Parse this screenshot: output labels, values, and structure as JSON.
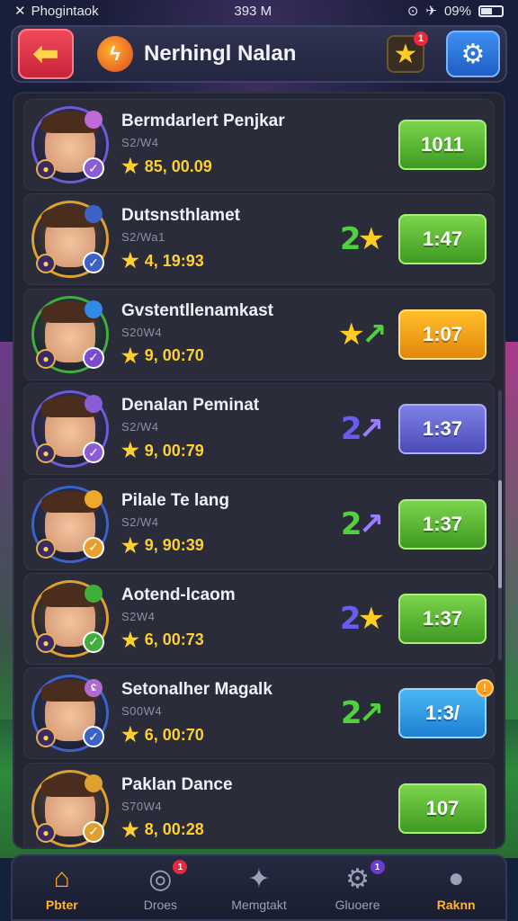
{
  "status_bar": {
    "app": "Phogintaok",
    "time": "393 M",
    "battery": "09%"
  },
  "header": {
    "title": "Nerhingl Nalan",
    "notif": "1"
  },
  "players": [
    {
      "name": "Bermdarlert Penjkar",
      "sub": "S2/W4",
      "score": "85, 00.09",
      "rank": "",
      "rank_colors": [
        "#ffffff",
        "#ffffff"
      ],
      "time": "1011",
      "btn": "green",
      "ring": "#6b5bd6",
      "badge_color": "#8a5cd6",
      "top_badge": "",
      "top_color": "#c06ad8",
      "alert": ""
    },
    {
      "name": "Dutsnsthlamet",
      "sub": "S2/Wa1",
      "score": "4, 19:93",
      "rank": "2★",
      "rank_colors": [
        "#4fd23c",
        "#ffcc22"
      ],
      "time": "1:47",
      "btn": "green",
      "ring": "#e0a030",
      "badge_color": "#3c62c8",
      "top_badge": "",
      "top_color": "#3c62c8",
      "alert": ""
    },
    {
      "name": "Gvstentllenamkast",
      "sub": "S20W4",
      "score": "9, 00:70",
      "rank": "★↗",
      "rank_colors": [
        "#ffcc22",
        "#4fd23c"
      ],
      "time": "1:07",
      "btn": "orange",
      "ring": "#3fae3c",
      "badge_color": "#7a4ad0",
      "top_badge": "",
      "top_color": "#2f8ae8",
      "alert": ""
    },
    {
      "name": "Denalan Peminat",
      "sub": "S2/W4",
      "score": "9, 00:79",
      "rank": "2↗",
      "rank_colors": [
        "#6a5cf0",
        "#9b7cff"
      ],
      "time": "1:37",
      "btn": "purple",
      "ring": "#6b5bd6",
      "badge_color": "#8a5cd6",
      "top_badge": "",
      "top_color": "#8a5cd6",
      "alert": ""
    },
    {
      "name": "Pilale Te lang",
      "sub": "S2/W4",
      "score": "9, 90:39",
      "rank": "2↗",
      "rank_colors": [
        "#4fd23c",
        "#9b7cff"
      ],
      "time": "1:37",
      "btn": "green",
      "ring": "#3c62c8",
      "badge_color": "#e8a02a",
      "top_badge": "",
      "top_color": "#f0a82a",
      "alert": ""
    },
    {
      "name": "Aotend-lcaom",
      "sub": "S2W4",
      "score": "6, 00:73",
      "rank": "2★",
      "rank_colors": [
        "#6a5cf0",
        "#ffcc22"
      ],
      "time": "1:37",
      "btn": "green",
      "ring": "#e0a030",
      "badge_color": "#3fae3c",
      "top_badge": "",
      "top_color": "#3fae3c",
      "alert": ""
    },
    {
      "name": "Setonalher Magalk",
      "sub": "S00W4",
      "score": "6, 00:70",
      "rank": "2↗",
      "rank_colors": [
        "#4fd23c",
        "#4fd23c"
      ],
      "time": "1:3/",
      "btn": "blue",
      "ring": "#3c62c8",
      "badge_color": "#3c62c8",
      "top_badge": "ʢ",
      "top_color": "#b06ad0",
      "alert": "!"
    },
    {
      "name": "Paklan Dance",
      "sub": "S70W4",
      "score": "8, 00:28",
      "rank": "",
      "rank_colors": [
        "#ffffff",
        "#ffffff"
      ],
      "time": "107",
      "btn": "green",
      "ring": "#e0a030",
      "badge_color": "#e0a030",
      "top_badge": "",
      "top_color": "#e0a030",
      "alert": ""
    }
  ],
  "nav": [
    {
      "label": "Pbter",
      "icon": "⌂",
      "active": true,
      "badge": "",
      "badge_color": "#e8283c"
    },
    {
      "label": "Droes",
      "icon": "◎",
      "active": false,
      "badge": "1",
      "badge_color": "#e8283c"
    },
    {
      "label": "Memgtakt",
      "icon": "✦",
      "active": false,
      "badge": "",
      "badge_color": "#e8283c"
    },
    {
      "label": "Gluoere",
      "icon": "⚙",
      "active": false,
      "badge": "1",
      "badge_color": "#6a3cd0"
    },
    {
      "label": "Raknn",
      "icon": "●",
      "active": false,
      "accent": true,
      "badge": "",
      "badge_color": "#e8283c"
    }
  ]
}
